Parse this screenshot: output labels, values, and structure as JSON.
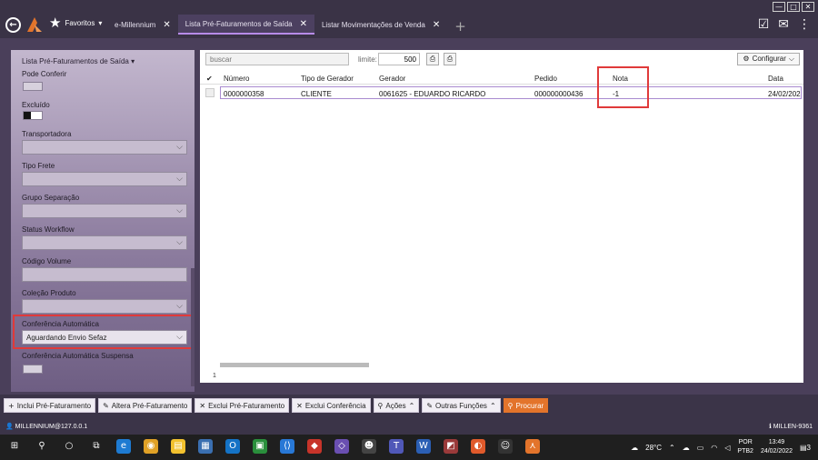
{
  "window": {
    "controls": [
      "—",
      "□",
      "✕"
    ]
  },
  "header": {
    "favoritos_label": "Favoritos",
    "tabs": [
      {
        "label": "e-Millennium",
        "closable": true,
        "active": false
      },
      {
        "label": "Lista Pré-Faturamentos de Saída",
        "closable": true,
        "active": true
      },
      {
        "label": "Listar Movimentações de Venda",
        "closable": true,
        "active": false
      }
    ]
  },
  "sidebar": {
    "title": "Lista Pré-Faturamentos de Saída",
    "fields": {
      "pode_conferir": "Pode Conferir",
      "excluido": "Excluído",
      "transportadora": "Transportadora",
      "tipo_frete": "Tipo Frete",
      "grupo_separacao": "Grupo Separação",
      "status_workflow": "Status Workflow",
      "codigo_volume": "Código Volume",
      "colecao_produto": "Coleção Produto",
      "conferencia_automatica": "Conferência Automática",
      "conferencia_automatica_value": "Aguardando Envio Sefaz",
      "conferencia_automatica_suspensa": "Conferência Automática Suspensa"
    }
  },
  "toolbar": {
    "search_placeholder": "buscar",
    "limit_label": "limite:",
    "limit_value": "500",
    "configurar_label": "Configurar"
  },
  "table": {
    "columns": [
      "Número",
      "Tipo de Gerador",
      "Gerador",
      "Pedido",
      "Nota",
      "Data"
    ],
    "rows": [
      {
        "numero": "0000000358",
        "tipo_gerador": "CLIENTE",
        "gerador": "0061625 - EDUARDO RICARDO",
        "pedido": "000000000436",
        "nota": "-1",
        "data": "24/02/202"
      }
    ],
    "row_count": "1"
  },
  "actions": [
    {
      "label": "Inclui Pré-Faturamento",
      "icon": "+"
    },
    {
      "label": "Altera Pré-Faturamento",
      "icon": "✎"
    },
    {
      "label": "Exclui Pré-Faturamento",
      "icon": "✕"
    },
    {
      "label": "Exclui Conferência",
      "icon": "✕"
    },
    {
      "label": "Ações",
      "icon": "⚲"
    },
    {
      "label": "Outras Funções",
      "icon": "✎"
    },
    {
      "label": "Procurar",
      "icon": "⚲"
    }
  ],
  "status": {
    "user": "MILLENNIUM@127.0.0.1",
    "server": "MILLEN-9361"
  },
  "taskbar": {
    "weather": "28°C",
    "lang": "POR",
    "lang2": "PTB2",
    "time": "13:49",
    "date": "24/02/2022",
    "notif_count": "3"
  },
  "colors": {
    "accent": "#e3742b",
    "highlight_box": "#e03a3a",
    "row_border": "#a98bd0"
  }
}
